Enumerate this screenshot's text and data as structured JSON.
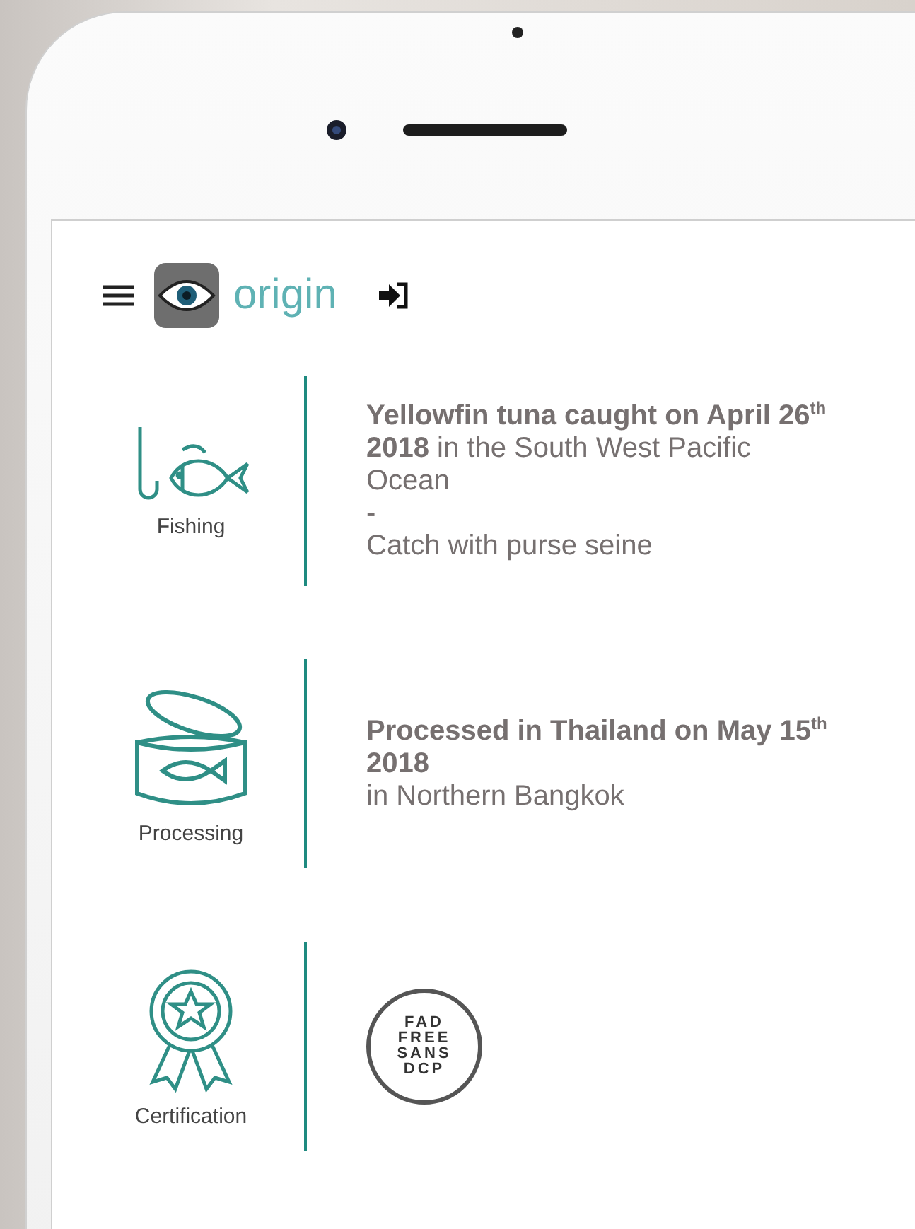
{
  "header": {
    "brand": "origin"
  },
  "steps": [
    {
      "kind": "fishing",
      "label": "Fishing",
      "paragraphs": [
        "**Yellowfin tuna caught on April 26$^{th}$ 2018** in the South West Pacific Ocean",
        "-",
        "Catch with purse seine"
      ]
    },
    {
      "kind": "processing",
      "label": "Processing",
      "paragraphs": [
        "**Processed in Thailand on May 15$^{th}$ 2018**",
        "in Northern Bangkok"
      ]
    },
    {
      "kind": "certification",
      "label": "Certification",
      "badge": [
        "FAD",
        "FREE",
        "SANS",
        "DCP"
      ]
    }
  ]
}
